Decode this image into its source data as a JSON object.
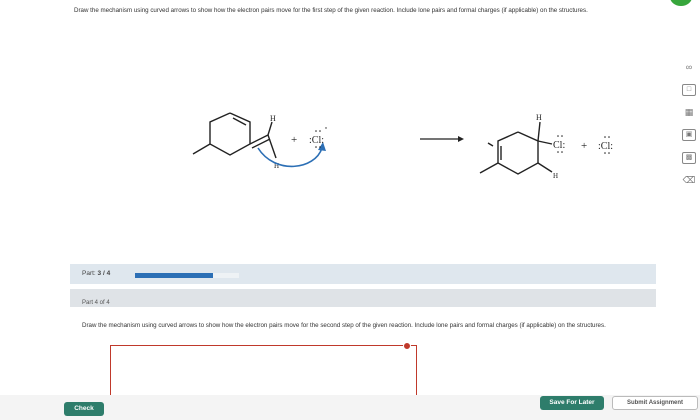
{
  "question": {
    "part3_text": "Draw the mechanism using curved arrows to show how the electron pairs move for the first step of the given reaction. Include lone pairs and formal charges (if applicable) on the structures."
  },
  "scheme": {
    "reactant_h_top": "H",
    "reactant_h_bottom": "H",
    "plus_1": "+",
    "chloride_reactant": ":Cl:",
    "product_h_top": "H",
    "product_h_bottom": "H",
    "chlorine_product": "Cl:",
    "plus_2": "+",
    "chloride_product": ":Cl:"
  },
  "toolbar": {
    "icons": [
      "infinity-icon",
      "lasso-icon",
      "periodic-table-icon",
      "template-icon",
      "grid-icon",
      "eraser-icon"
    ],
    "infinity_glyph": "∞"
  },
  "progress": {
    "label_prefix": "Part:",
    "current": "3",
    "separator": "/",
    "total": "4",
    "fraction_complete": 0.75,
    "bar_color": "#2c6fb5"
  },
  "part4": {
    "title": "Part 4 of 4",
    "text": "Draw the mechanism using curved arrows to show how the electron pairs move for the second step of the given reaction. Include lone pairs and formal charges (if applicable) on the structures."
  },
  "buttons": {
    "check": "Check",
    "save": "Save For Later",
    "submit": "Submit Assignment"
  },
  "colors": {
    "accent_green": "#2e7d6b",
    "arrow_blue": "#2c6fb5",
    "error_red": "#c0392b",
    "brand_green": "#37a63c"
  }
}
